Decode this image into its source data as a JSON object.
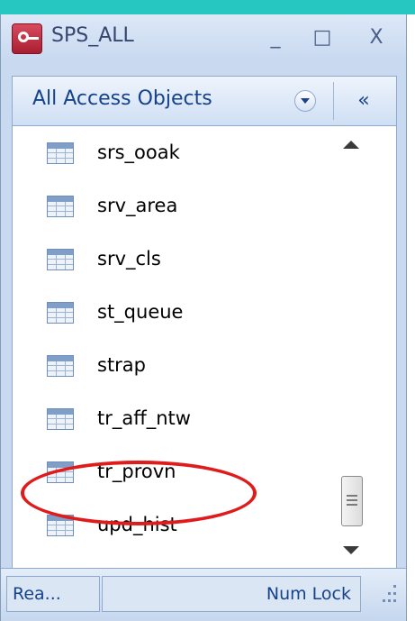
{
  "window": {
    "title": "SPS_ALL",
    "minimize_label": "_",
    "maximize_label": "□",
    "close_label": "X"
  },
  "nav_pane": {
    "title": "All Access Objects",
    "collapse_label": "«",
    "items": [
      {
        "label": "srs_ooak",
        "icon": "table-icon"
      },
      {
        "label": "srv_area",
        "icon": "table-icon"
      },
      {
        "label": "srv_cls",
        "icon": "table-icon"
      },
      {
        "label": "st_queue",
        "icon": "table-icon"
      },
      {
        "label": "strap",
        "icon": "table-icon"
      },
      {
        "label": "tr_aff_ntw",
        "icon": "table-icon"
      },
      {
        "label": "tr_provn",
        "icon": "table-icon"
      },
      {
        "label": "upd_hist",
        "icon": "table-icon"
      }
    ]
  },
  "statusbar": {
    "ready": "Rea...",
    "num_lock": "Num Lock"
  },
  "colors": {
    "accent": "#15428b",
    "highlight": "#e01b1b",
    "top_strip": "#27c7c1"
  }
}
